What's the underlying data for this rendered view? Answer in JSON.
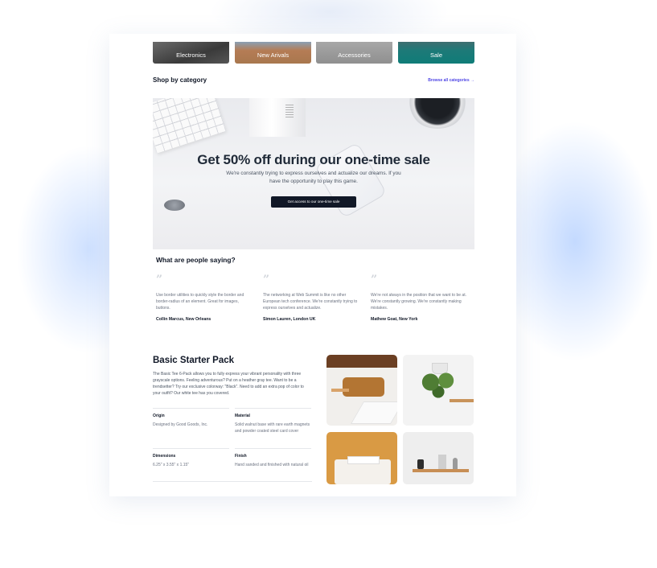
{
  "categories": [
    {
      "label": "Electronics"
    },
    {
      "label": "New Arivals"
    },
    {
      "label": "Accessories"
    },
    {
      "label": "Sale"
    }
  ],
  "shop": {
    "title": "Shop by category",
    "browse_link": "Browse all categories →"
  },
  "hero": {
    "title": "Get 50% off during our one-time sale",
    "subtitle": "We're constantly trying to express ourselves and actualize our dreams. If you have the opportunity to play this game.",
    "button_label": "Get access to our one-time sale"
  },
  "testimonials": {
    "title": "What are people saying?",
    "quote_mark": "”",
    "items": [
      {
        "text": "Use border utilities to quickly style the border and border-radius of an element. Great for images, buttons.",
        "author": "Collin Marcus, New Orleans"
      },
      {
        "text": "The networking at Web Summit is like no other European tech conference. We're constantly trying to express ourselves and actualize.",
        "author": "Simon Lauren, London UK"
      },
      {
        "text": "We're not always in the position that we want to be at. We're constantly growing. We're constantly making mistakes.",
        "author": "Mathew Goat, New York"
      }
    ]
  },
  "pack": {
    "title": "Basic Starter Pack",
    "description": "The Basic Tee 6-Pack allows you to fully express your vibrant personality with three grayscale options. Feeling adventurous? Put on a heather gray tee. Want to be a trendsetter? Try our exclusive colorway: \"Black\". Need to add an extra pop of color to your outfit? Our white tee has you covered.",
    "specs": [
      {
        "label": "Origin",
        "value": "Designed by Good Goods, Inc."
      },
      {
        "label": "Material",
        "value": "Solid walnut base with rare earth magnets and powder coated steel card cover"
      },
      {
        "label": "Dimensions",
        "value": "6.25\" x 3.55\" x 1.15\""
      },
      {
        "label": "Finish",
        "value": "Hand sanded and finished with natural oil"
      }
    ]
  }
}
